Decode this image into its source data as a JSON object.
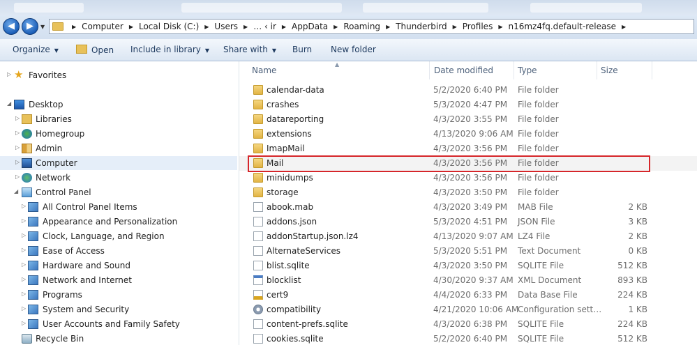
{
  "breadcrumb": [
    "Computer",
    "Local Disk (C:)",
    "Users",
    "… ‹ ir",
    "AppData",
    "Roaming",
    "Thunderbird",
    "Profiles",
    "n16mz4fq.default-release"
  ],
  "toolbar": {
    "organize": "Organize",
    "open": "Open",
    "include_in_library": "Include in library",
    "share_with": "Share with",
    "burn": "Burn",
    "new_folder": "New folder"
  },
  "nav": {
    "favorites": "Favorites",
    "desktop": "Desktop",
    "libraries": "Libraries",
    "homegroup": "Homegroup",
    "admin": "Admin",
    "computer": "Computer",
    "network": "Network",
    "control_panel": "Control Panel",
    "cp_items": [
      "All Control Panel Items",
      "Appearance and Personalization",
      "Clock, Language, and Region",
      "Ease of Access",
      "Hardware and Sound",
      "Network and Internet",
      "Programs",
      "System and Security",
      "User Accounts and Family Safety"
    ],
    "recycle_bin": "Recycle Bin"
  },
  "columns": {
    "name": "Name",
    "date": "Date modified",
    "type": "Type",
    "size": "Size"
  },
  "files": [
    {
      "name": "calendar-data",
      "date": "5/2/2020 6:40 PM",
      "type": "File folder",
      "size": "",
      "icon": "folder"
    },
    {
      "name": "crashes",
      "date": "5/3/2020 4:47 PM",
      "type": "File folder",
      "size": "",
      "icon": "folder"
    },
    {
      "name": "datareporting",
      "date": "4/3/2020 3:55 PM",
      "type": "File folder",
      "size": "",
      "icon": "folder"
    },
    {
      "name": "extensions",
      "date": "4/13/2020 9:06 AM",
      "type": "File folder",
      "size": "",
      "icon": "folder"
    },
    {
      "name": "ImapMail",
      "date": "4/3/2020 3:56 PM",
      "type": "File folder",
      "size": "",
      "icon": "folder"
    },
    {
      "name": "Mail",
      "date": "4/3/2020 3:56 PM",
      "type": "File folder",
      "size": "",
      "icon": "folder"
    },
    {
      "name": "minidumps",
      "date": "4/3/2020 3:56 PM",
      "type": "File folder",
      "size": "",
      "icon": "folder"
    },
    {
      "name": "storage",
      "date": "4/3/2020 3:50 PM",
      "type": "File folder",
      "size": "",
      "icon": "folder"
    },
    {
      "name": "abook.mab",
      "date": "4/3/2020 3:49 PM",
      "type": "MAB File",
      "size": "2 KB",
      "icon": "file"
    },
    {
      "name": "addons.json",
      "date": "5/3/2020 4:51 PM",
      "type": "JSON File",
      "size": "3 KB",
      "icon": "file"
    },
    {
      "name": "addonStartup.json.lz4",
      "date": "4/13/2020 9:07 AM",
      "type": "LZ4 File",
      "size": "2 KB",
      "icon": "file"
    },
    {
      "name": "AlternateServices",
      "date": "5/3/2020 5:51 PM",
      "type": "Text Document",
      "size": "0 KB",
      "icon": "file"
    },
    {
      "name": "blist.sqlite",
      "date": "4/3/2020 3:50 PM",
      "type": "SQLITE File",
      "size": "512 KB",
      "icon": "file"
    },
    {
      "name": "blocklist",
      "date": "4/30/2020 9:37 AM",
      "type": "XML Document",
      "size": "893 KB",
      "icon": "xml"
    },
    {
      "name": "cert9",
      "date": "4/4/2020 6:33 PM",
      "type": "Data Base File",
      "size": "224 KB",
      "icon": "cert"
    },
    {
      "name": "compatibility",
      "date": "4/21/2020 10:06 AM",
      "type": "Configuration sett…",
      "size": "1 KB",
      "icon": "gear"
    },
    {
      "name": "content-prefs.sqlite",
      "date": "4/3/2020 6:38 PM",
      "type": "SQLITE File",
      "size": "224 KB",
      "icon": "file"
    },
    {
      "name": "cookies.sqlite",
      "date": "5/2/2020 6:40 PM",
      "type": "SQLITE File",
      "size": "512 KB",
      "icon": "file"
    }
  ],
  "highlight_color": "#d6262a"
}
